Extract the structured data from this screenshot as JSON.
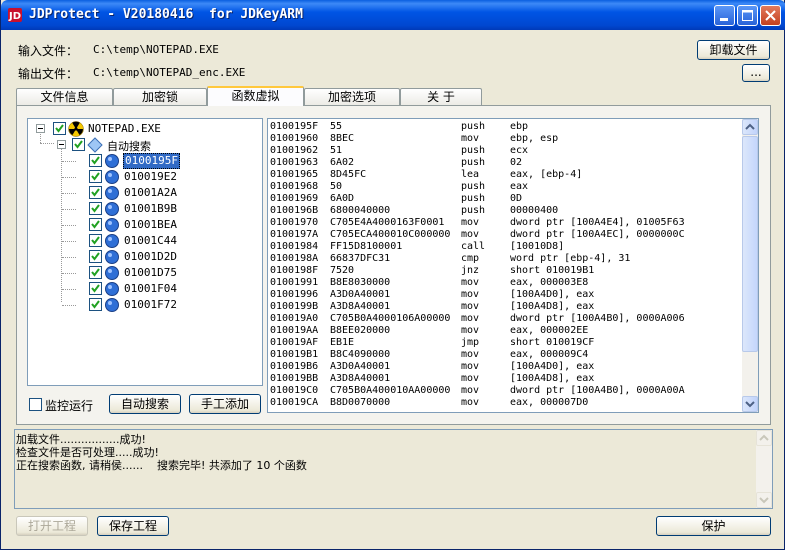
{
  "window": {
    "title": "JDProtect - V20180416  for JDKeyARM",
    "accent": "#0055e5"
  },
  "files": {
    "input_label": "输入文件：",
    "input_path": "C:\\temp\\NOTEPAD.EXE",
    "output_label": "输出文件：",
    "output_path": "C:\\temp\\NOTEPAD_enc.EXE",
    "unload_button": "卸载文件",
    "browse_button": "..."
  },
  "tabs": [
    {
      "label": "文件信息"
    },
    {
      "label": "加密锁"
    },
    {
      "label": "函数虚拟"
    },
    {
      "label": "加密选项"
    },
    {
      "label": "关  于"
    }
  ],
  "tree": {
    "root": "NOTEPAD.EXE",
    "group": "自动搜索",
    "items": [
      "0100195F",
      "010019E2",
      "01001A2A",
      "01001B9B",
      "01001BEA",
      "01001C44",
      "01001D2D",
      "01001D75",
      "01001F04",
      "01001F72"
    ]
  },
  "controls": {
    "monitor_label": "监控运行",
    "auto_search_button": "自动搜索",
    "manual_add_button": "手工添加"
  },
  "disasm": [
    [
      "0100195F",
      "55",
      "push",
      "ebp"
    ],
    [
      "01001960",
      "8BEC",
      "mov",
      "ebp, esp"
    ],
    [
      "01001962",
      "51",
      "push",
      "ecx"
    ],
    [
      "01001963",
      "6A02",
      "push",
      "02"
    ],
    [
      "01001965",
      "8D45FC",
      "lea",
      "eax, [ebp-4]"
    ],
    [
      "01001968",
      "50",
      "push",
      "eax"
    ],
    [
      "01001969",
      "6A0D",
      "push",
      "0D"
    ],
    [
      "0100196B",
      "6800040000",
      "push",
      "00000400"
    ],
    [
      "01001970",
      "C705E4A4000163F0001",
      "mov",
      "dword ptr [100A4E4], 01005F63"
    ],
    [
      "0100197A",
      "C705ECA400010C000000",
      "mov",
      "dword ptr [100A4EC], 0000000C"
    ],
    [
      "01001984",
      "FF15D8100001",
      "call",
      "[10010D8]"
    ],
    [
      "0100198A",
      "66837DFC31",
      "cmp",
      "word ptr [ebp-4], 31"
    ],
    [
      "0100198F",
      "7520",
      "jnz",
      "short 010019B1"
    ],
    [
      "01001991",
      "B8E8030000",
      "mov",
      "eax, 000003E8"
    ],
    [
      "01001996",
      "A3D0A40001",
      "mov",
      "[100A4D0], eax"
    ],
    [
      "0100199B",
      "A3D8A40001",
      "mov",
      "[100A4D8], eax"
    ],
    [
      "010019A0",
      "C705B0A4000106A00000",
      "mov",
      "dword ptr [100A4B0], 0000A006"
    ],
    [
      "010019AA",
      "B8EE020000",
      "mov",
      "eax, 000002EE"
    ],
    [
      "010019AF",
      "EB1E",
      "jmp",
      "short 010019CF"
    ],
    [
      "010019B1",
      "B8C4090000",
      "mov",
      "eax, 000009C4"
    ],
    [
      "010019B6",
      "A3D0A40001",
      "mov",
      "[100A4D0], eax"
    ],
    [
      "010019BB",
      "A3D8A40001",
      "mov",
      "[100A4D8], eax"
    ],
    [
      "010019C0",
      "C705B0A400010AA00000",
      "mov",
      "dword ptr [100A4B0], 0000A00A"
    ],
    [
      "010019CA",
      "B8D0070000",
      "mov",
      "eax, 000007D0"
    ]
  ],
  "log": {
    "lines": [
      "加载文件.................成功!",
      "检查文件是否可处理.....成功!",
      "正在搜索函数, 请稍侯......    搜索完毕! 共添加了 10 个函数"
    ]
  },
  "footer": {
    "open_project": "打开工程",
    "save_project": "保存工程",
    "protect": "保护"
  }
}
